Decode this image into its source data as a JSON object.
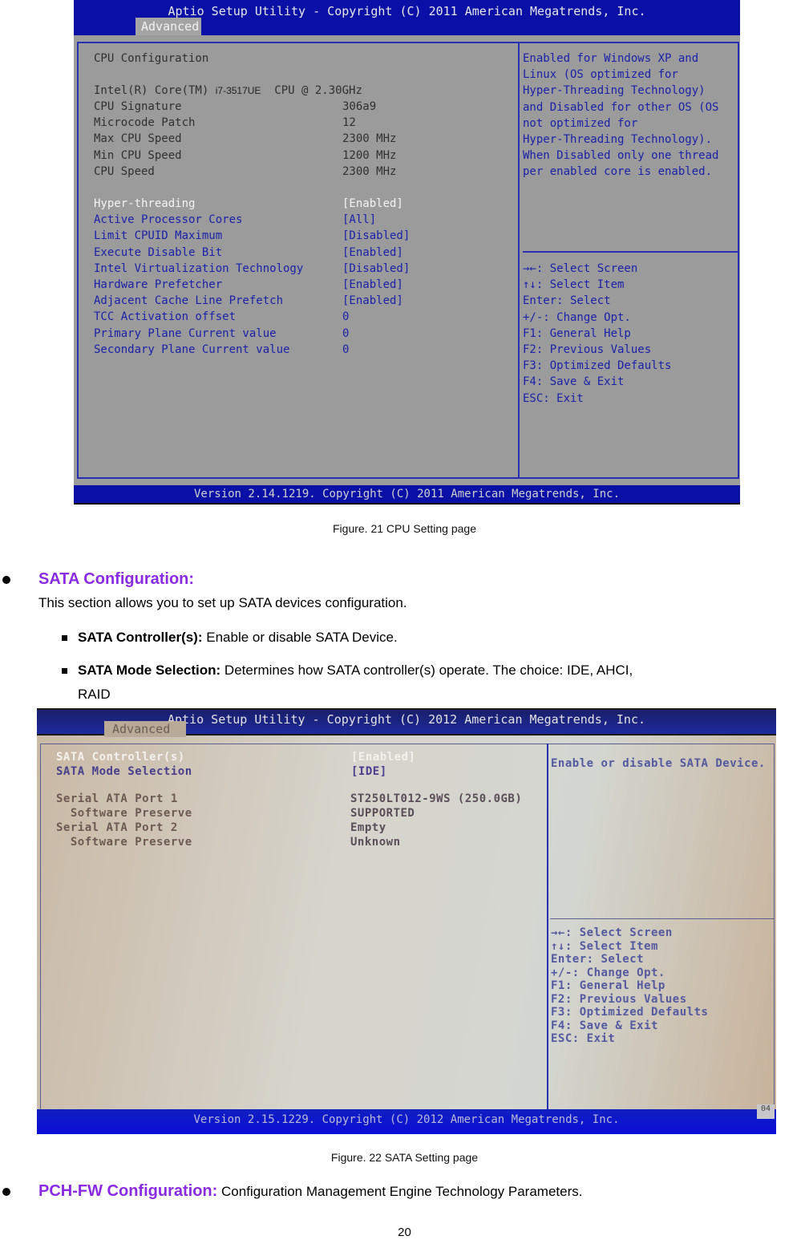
{
  "figure21": {
    "title": "Aptio Setup Utility - Copyright (C) 2011 American Megatrends, Inc.",
    "active_tab": "Advanced",
    "footer": "Version 2.14.1219. Copyright (C) 2011 American Megatrends, Inc.",
    "section_title": "CPU Configuration",
    "processor": {
      "prefix": "Intel(R) Core(TM)",
      "model": "i7-3517UE",
      "suffix": "CPU @ 2.30GHz"
    },
    "info_rows": [
      {
        "label": "CPU Signature",
        "value": "306a9"
      },
      {
        "label": "Microcode Patch",
        "value": "12"
      },
      {
        "label": "Max CPU Speed",
        "value": "2300 MHz"
      },
      {
        "label": "Min CPU Speed",
        "value": "1200 MHz"
      },
      {
        "label": "CPU Speed",
        "value": "2300 MHz"
      }
    ],
    "settings": [
      {
        "label": "Hyper-threading",
        "value": "[Enabled]",
        "selected": true
      },
      {
        "label": "Active Processor Cores",
        "value": "[All]"
      },
      {
        "label": "Limit CPUID Maximum",
        "value": "[Disabled]"
      },
      {
        "label": "Execute Disable Bit",
        "value": "[Enabled]"
      },
      {
        "label": "Intel Virtualization Technology",
        "value": "[Disabled]"
      },
      {
        "label": "Hardware Prefetcher",
        "value": "[Enabled]"
      },
      {
        "label": "Adjacent Cache Line Prefetch",
        "value": "[Enabled]"
      },
      {
        "label": "TCC Activation offset",
        "value": "0"
      },
      {
        "label": "Primary Plane Current value",
        "value": "0"
      },
      {
        "label": "Secondary Plane Current value",
        "value": "0"
      }
    ],
    "help_text": [
      "Enabled for Windows XP and",
      "Linux (OS optimized for",
      "Hyper-Threading Technology)",
      "and Disabled for other OS (OS",
      "not optimized for",
      "Hyper-Threading Technology).",
      "When Disabled only one thread",
      "per enabled core is enabled."
    ],
    "key_help": [
      "→←: Select Screen",
      "↑↓: Select Item",
      "Enter: Select",
      "+/-: Change Opt.",
      "F1: General Help",
      "F2: Previous Values",
      "F3: Optimized Defaults",
      "F4: Save & Exit",
      "ESC: Exit"
    ],
    "caption": "Figure. 21 CPU Setting page"
  },
  "sata_section": {
    "heading": "SATA Configuration:",
    "intro": "This section allows you to set up SATA devices configuration.",
    "items": [
      {
        "term": "SATA Controller(s):",
        "desc": " Enable or disable SATA Device."
      },
      {
        "term": "SATA Mode Selection:",
        "desc": " Determines how SATA controller(s) operate. The choice: IDE, AHCI,",
        "desc_cont": "RAID"
      }
    ]
  },
  "figure22": {
    "title": "Aptio Setup Utility - Copyright (C) 2012 American Megatrends, Inc.",
    "active_tab": "Advanced",
    "footer": "Version 2.15.1229. Copyright (C) 2012 American Megatrends, Inc.",
    "footer_corner": "04",
    "settings": [
      {
        "label": "SATA Controller(s)",
        "value": "[Enabled]",
        "selected": true
      },
      {
        "label": "SATA Mode Selection",
        "value": "[IDE]"
      }
    ],
    "ports": [
      {
        "label": "Serial ATA Port 1",
        "value": "ST250LT012-9WS (250.0GB)"
      },
      {
        "label": "  Software Preserve",
        "value": "SUPPORTED"
      },
      {
        "label": "Serial ATA Port 2",
        "value": "Empty"
      },
      {
        "label": "  Software Preserve",
        "value": "Unknown"
      }
    ],
    "help_text": "Enable or disable SATA Device.",
    "key_help": [
      "→←: Select Screen",
      "↑↓: Select Item",
      "Enter: Select",
      "+/-: Change Opt.",
      "F1: General Help",
      "F2: Previous Values",
      "F3: Optimized Defaults",
      "F4: Save & Exit",
      "ESC: Exit"
    ],
    "caption": "Figure. 22 SATA Setting page"
  },
  "pch_section": {
    "heading": "PCH-FW Configuration:",
    "desc": " Configuration Management Engine Technology Parameters."
  },
  "page_number": "20"
}
